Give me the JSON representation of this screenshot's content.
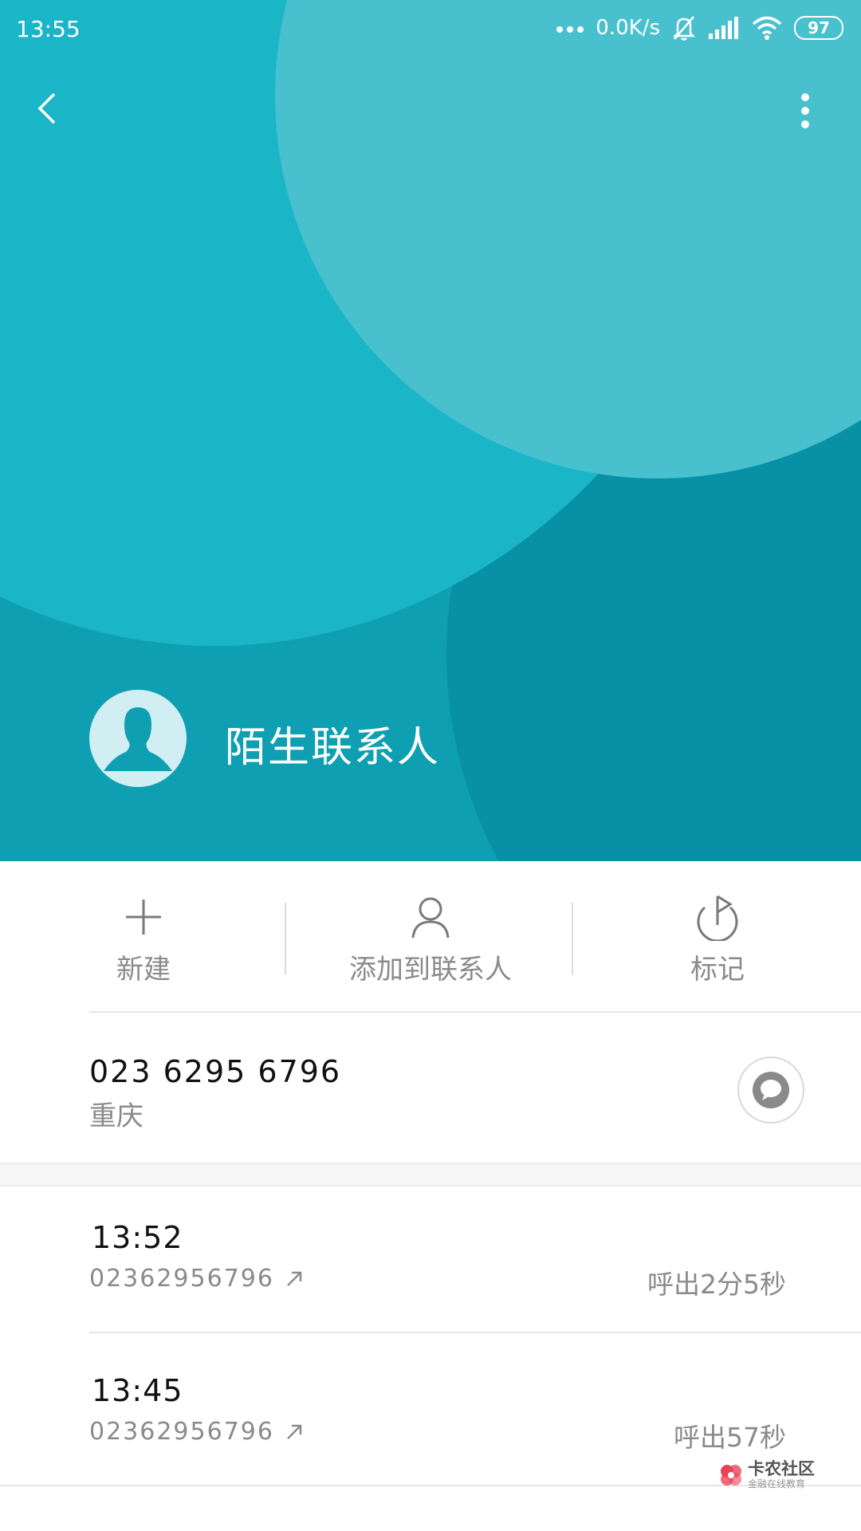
{
  "status_bar": {
    "time": "13:55",
    "network_speed": "0.0K/s",
    "battery": "97",
    "icons": [
      "dots-icon",
      "mute-bell-icon",
      "signal-icon",
      "wifi-icon",
      "battery-icon"
    ]
  },
  "header": {
    "contact_name": "陌生联系人",
    "colors": {
      "hero_bg": "#0f9fb2",
      "circle_light": "#49c0ce",
      "circle_mid": "#1bb5c8",
      "circle_dark": "#0891a6"
    }
  },
  "actions": [
    {
      "label": "新建",
      "icon": "plus-icon"
    },
    {
      "label": "添加到联系人",
      "icon": "person-icon"
    },
    {
      "label": "标记",
      "icon": "flag-icon"
    }
  ],
  "number": {
    "value": "023 6295 6796",
    "location": "重庆"
  },
  "calls": [
    {
      "time": "13:52",
      "number": "02362956796",
      "duration": "呼出2分5秒"
    },
    {
      "time": "13:45",
      "number": "02362956796",
      "duration": "呼出57秒"
    }
  ],
  "watermark": {
    "main": "卡农社区",
    "sub": "金融在线教育"
  }
}
